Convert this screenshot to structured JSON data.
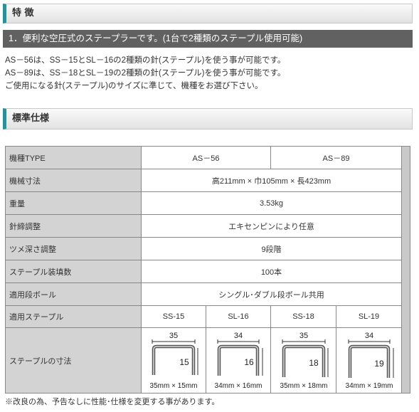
{
  "features": {
    "title": "特 徴",
    "subheading": "1．便利な空圧式のステープラーです。(1台で2種類のステープル使用可能)",
    "lines": [
      "AS－56は、SS－15とSL－16の2種類の針(ステープル)を使う事が可能です。",
      "AS－89は、SS－18とSL－19の2種類の針(ステープル)を使う事が可能です。",
      "ご使用になる針(ステープル)のサイズに準じて、機種をお選び下さい。"
    ]
  },
  "specs": {
    "title": "標準仕様",
    "model_label": "機種TYPE",
    "models": [
      "AS－56",
      "AS－89"
    ],
    "rows": [
      {
        "label": "機械寸法",
        "value": "高211mm × 巾105mm × 長423mm"
      },
      {
        "label": "重量",
        "value": "3.53kg"
      },
      {
        "label": "針締調整",
        "value": "エキセンピンにより任意"
      },
      {
        "label": "ツメ深さ調整",
        "value": "9段階"
      },
      {
        "label": "ステープル装填数",
        "value": "100本"
      },
      {
        "label": "適用段ボール",
        "value": "シングル･ダブル段ボール共用"
      }
    ],
    "staple_label": "適用ステープル",
    "staples": [
      "SS-15",
      "SL-16",
      "SS-18",
      "SL-19"
    ],
    "size_label": "ステープルの寸法",
    "staple_sizes": [
      {
        "width": "35",
        "leg": "15",
        "caption": "35mm × 15mm"
      },
      {
        "width": "34",
        "leg": "16",
        "caption": "34mm × 16mm"
      },
      {
        "width": "35",
        "leg": "18",
        "caption": "35mm × 18mm"
      },
      {
        "width": "34",
        "leg": "19",
        "caption": "34mm × 19mm"
      }
    ]
  },
  "note": "※改良の為、予告なしに性能･仕様を変更する事があります。"
}
